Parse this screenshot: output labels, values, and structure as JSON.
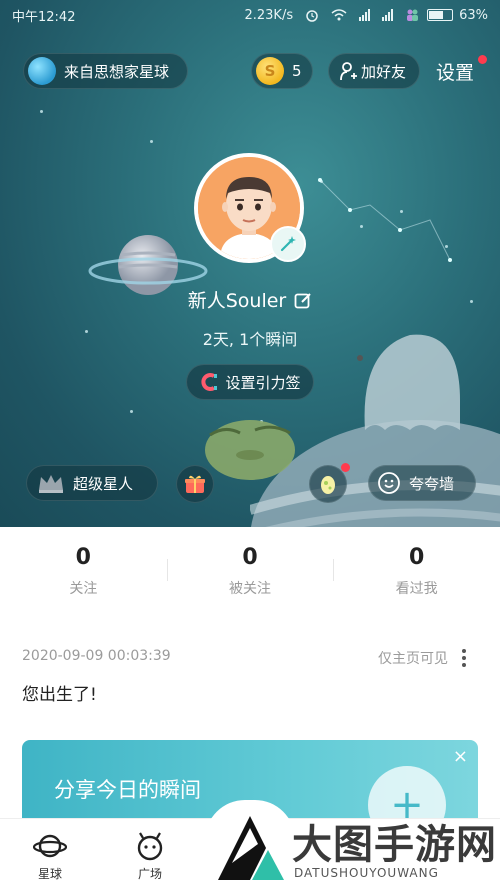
{
  "status_bar": {
    "time": "中午12:42",
    "speed": "2.23K/s",
    "battery": "63%"
  },
  "header": {
    "planet_label": "来自思想家星球",
    "coins": "5",
    "add_friend_label": "加好友",
    "settings_label": "设置"
  },
  "profile": {
    "name": "新人Souler",
    "days_line": "2天, 1个瞬间",
    "gravity_tag_label": "设置引力签",
    "super_star_label": "超级星人",
    "praise_wall_label": "夸夸墙"
  },
  "stats": [
    {
      "value": "0",
      "label": "关注"
    },
    {
      "value": "0",
      "label": "被关注"
    },
    {
      "value": "0",
      "label": "看过我"
    }
  ],
  "post": {
    "timestamp": "2020-09-09 00:03:39",
    "visibility": "仅主页可见",
    "text": "您出生了!"
  },
  "share_card": {
    "title": "分享今日的瞬间",
    "close": "×",
    "plus": "+"
  },
  "bottom_nav": {
    "items": [
      {
        "label": "星球"
      },
      {
        "label": "广场"
      }
    ]
  },
  "watermark": {
    "title": "大图手游网",
    "subtitle": "DATUSHOUYOUWANG"
  },
  "colors": {
    "hero_bg": "#2b6f7a",
    "accent": "#46b9c8",
    "notification_dot": "#ff3b4e"
  }
}
